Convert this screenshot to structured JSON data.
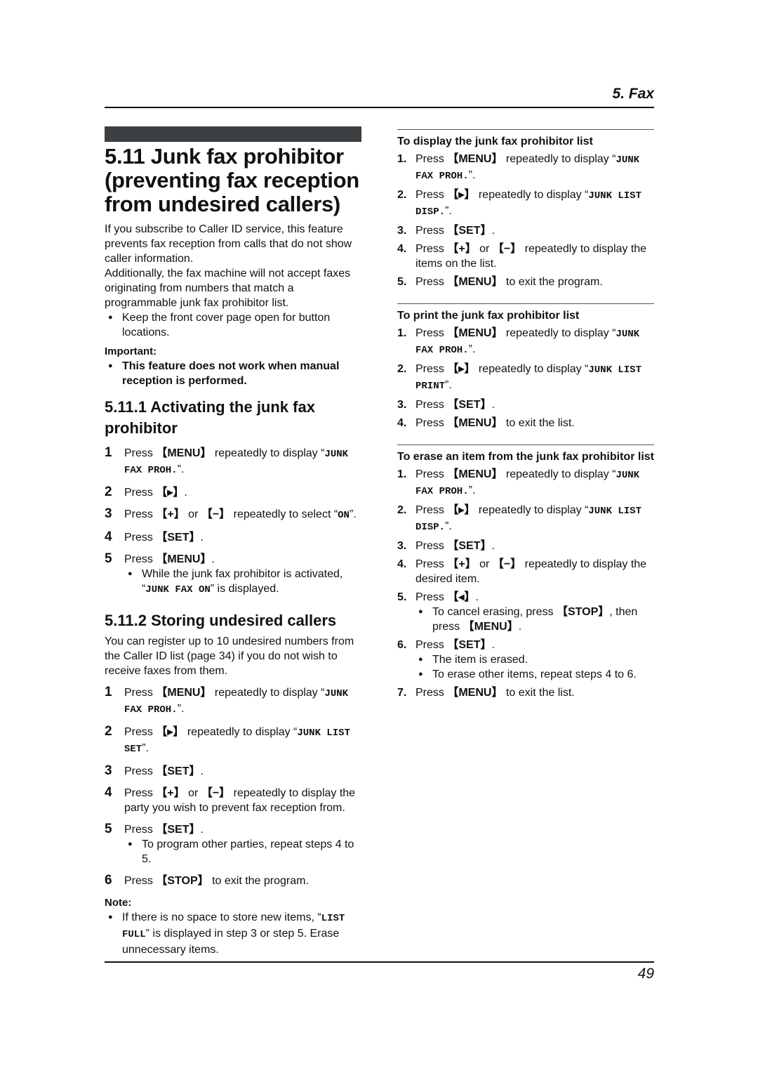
{
  "header": {
    "chapter": "5. Fax"
  },
  "footer": {
    "page_number": "49"
  },
  "main": {
    "title_number": "5.11",
    "title_text": "Junk fax prohibitor (preventing fax reception from undesired callers)",
    "intro_1": "If you subscribe to Caller ID service, this feature prevents fax reception from calls that do not show caller information.",
    "intro_2": "Additionally, the fax machine will not accept faxes originating from numbers that match a programmable junk fax prohibitor list.",
    "intro_bullet": "Keep the front cover page open for button locations.",
    "important_label": "Important:",
    "important_bullet": "This feature does not work when manual reception is performed."
  },
  "activating": {
    "heading": "5.11.1 Activating the junk fax prohibitor",
    "steps": [
      {
        "n": "1",
        "pre": "Press ",
        "key": "【MENU】",
        "mid": " repeatedly to display “",
        "mono": "JUNK FAX PROH.",
        "post": "”."
      },
      {
        "n": "2",
        "pre": "Press ",
        "key": "【▸】",
        "post": "."
      },
      {
        "n": "3",
        "pre": "Press ",
        "key": "【+】",
        "mid": " or ",
        "key2": "【−】",
        "mid2": " repeatedly to select “",
        "mono": "ON",
        "post": "”."
      },
      {
        "n": "4",
        "pre": "Press ",
        "key": "【SET】",
        "post": "."
      },
      {
        "n": "5",
        "pre": "Press ",
        "key": "【MENU】",
        "post": ".",
        "bullet_pre": "While the junk fax prohibitor is activated, “",
        "bullet_mono": "JUNK FAX ON",
        "bullet_post": "” is displayed."
      }
    ]
  },
  "storing": {
    "heading": "5.11.2 Storing undesired callers",
    "intro": "You can register up to 10 undesired numbers from the Caller ID list (page 34) if you do not wish to receive faxes from them.",
    "steps": [
      {
        "n": "1",
        "pre": "Press ",
        "key": "【MENU】",
        "mid": " repeatedly to display “",
        "mono": "JUNK FAX PROH.",
        "post": "”."
      },
      {
        "n": "2",
        "pre": "Press ",
        "key": "【▸】",
        "mid": " repeatedly to display “",
        "mono": "JUNK LIST SET",
        "post": "”."
      },
      {
        "n": "3",
        "pre": "Press ",
        "key": "【SET】",
        "post": "."
      },
      {
        "n": "4",
        "pre": "Press ",
        "key": "【+】",
        "mid": " or ",
        "key2": "【−】",
        "post": " repeatedly to display the party you wish to prevent fax reception from."
      },
      {
        "n": "5",
        "pre": "Press ",
        "key": "【SET】",
        "post": ".",
        "bullet": "To program other parties, repeat steps 4 to 5."
      },
      {
        "n": "6",
        "pre": "Press ",
        "key": "【STOP】",
        "post": " to exit the program."
      }
    ],
    "note_label": "Note:",
    "note_pre": "If there is no space to store new items, “",
    "note_mono": "LIST FULL",
    "note_post": "” is displayed in step 3 or step 5. Erase unnecessary items."
  },
  "display_list": {
    "heading": "To display the junk fax prohibitor list",
    "steps": [
      {
        "n": "1.",
        "pre": "Press ",
        "key": "【MENU】",
        "mid": " repeatedly to display “",
        "mono": "JUNK FAX PROH.",
        "post": "”."
      },
      {
        "n": "2.",
        "pre": "Press ",
        "key": "【▸】",
        "mid": " repeatedly to display “",
        "mono": "JUNK LIST DISP.",
        "post": "”."
      },
      {
        "n": "3.",
        "pre": "Press ",
        "key": "【SET】",
        "post": "."
      },
      {
        "n": "4.",
        "pre": "Press ",
        "key": "【+】",
        "mid": " or ",
        "key2": "【−】",
        "post": " repeatedly to display the items on the list."
      },
      {
        "n": "5.",
        "pre": "Press ",
        "key": "【MENU】",
        "post": " to exit the program."
      }
    ]
  },
  "print_list": {
    "heading": "To print the junk fax prohibitor list",
    "steps": [
      {
        "n": "1.",
        "pre": "Press ",
        "key": "【MENU】",
        "mid": " repeatedly to display “",
        "mono": "JUNK FAX PROH.",
        "post": "”."
      },
      {
        "n": "2.",
        "pre": "Press ",
        "key": "【▸】",
        "mid": " repeatedly to display “",
        "mono": "JUNK LIST PRINT",
        "post": "”."
      },
      {
        "n": "3.",
        "pre": "Press ",
        "key": "【SET】",
        "post": "."
      },
      {
        "n": "4.",
        "pre": "Press ",
        "key": "【MENU】",
        "post": " to exit the list."
      }
    ]
  },
  "erase_item": {
    "heading": "To erase an item from the junk fax prohibitor list",
    "steps": [
      {
        "n": "1.",
        "pre": "Press ",
        "key": "【MENU】",
        "mid": " repeatedly to display “",
        "mono": "JUNK FAX PROH.",
        "post": "”."
      },
      {
        "n": "2.",
        "pre": "Press ",
        "key": "【▸】",
        "mid": " repeatedly to display “",
        "mono": "JUNK LIST DISP.",
        "post": "”."
      },
      {
        "n": "3.",
        "pre": "Press ",
        "key": "【SET】",
        "post": "."
      },
      {
        "n": "4.",
        "pre": "Press ",
        "key": "【+】",
        "mid": " or ",
        "key2": "【−】",
        "post": " repeatedly to display the desired item."
      },
      {
        "n": "5.",
        "pre": "Press ",
        "key": "【◂】",
        "post": "."
      },
      {
        "n": "6.",
        "pre": "Press ",
        "key": "【SET】",
        "post": "."
      },
      {
        "n": "7.",
        "pre": "Press ",
        "key": "【MENU】",
        "post": " to exit the list."
      }
    ],
    "step5_bullet_pre": "To cancel erasing, press ",
    "step5_bullet_key1": "【STOP】",
    "step5_bullet_mid": ", then press ",
    "step5_bullet_key2": "【MENU】",
    "step5_bullet_post": ".",
    "step6_bullets": [
      "The item is erased.",
      "To erase other items, repeat steps 4 to 6."
    ]
  }
}
